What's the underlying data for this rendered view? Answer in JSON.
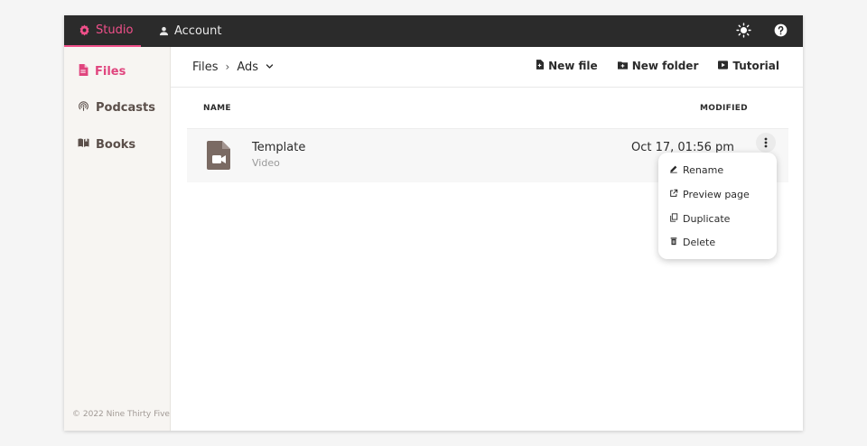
{
  "topbar": {
    "tabs": [
      {
        "label": "Studio",
        "icon": "gear-icon",
        "active": true
      },
      {
        "label": "Account",
        "icon": "person-icon",
        "active": false
      }
    ],
    "theme_icon": "sun-icon",
    "help_icon": "help-icon"
  },
  "sidebar": {
    "items": [
      {
        "label": "Files",
        "icon": "file-icon",
        "active": true
      },
      {
        "label": "Podcasts",
        "icon": "podcast-icon",
        "active": false
      },
      {
        "label": "Books",
        "icon": "book-icon",
        "active": false
      }
    ],
    "copyright": "© 2022 Nine Thirty Five"
  },
  "breadcrumb": {
    "root": "Files",
    "separator": "›",
    "current": "Ads"
  },
  "actions": {
    "new_file": "New file",
    "new_folder": "New folder",
    "tutorial": "Tutorial"
  },
  "table": {
    "headers": {
      "name": "NAME",
      "modified": "MODIFIED"
    },
    "rows": [
      {
        "name": "Template",
        "type": "Video",
        "modified": "Oct 17, 01:56 pm",
        "icon": "video-file-icon"
      }
    ]
  },
  "context_menu": {
    "items": [
      {
        "label": "Rename",
        "icon": "pencil-icon"
      },
      {
        "label": "Preview page",
        "icon": "external-link-icon"
      },
      {
        "label": "Duplicate",
        "icon": "copy-icon"
      },
      {
        "label": "Delete",
        "icon": "trash-icon"
      }
    ]
  },
  "colors": {
    "accent": "#e0457e",
    "topbar": "#2b2b2b",
    "sidebar": "#f7f5f2"
  }
}
